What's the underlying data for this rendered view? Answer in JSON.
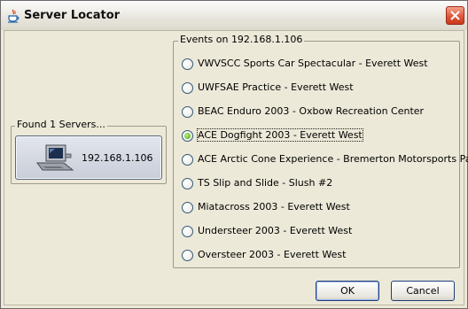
{
  "window": {
    "title": "Server Locator"
  },
  "servers_panel": {
    "legend": "Found 1 Servers...",
    "servers": [
      {
        "address": "192.168.1.106"
      }
    ]
  },
  "events_panel": {
    "legend": "Events on 192.168.1.106",
    "events": [
      {
        "label": "VWVSCC Sports Car Spectacular - Everett West",
        "selected": false
      },
      {
        "label": "UWFSAE Practice - Everett West",
        "selected": false
      },
      {
        "label": "BEAC Enduro 2003 - Oxbow Recreation Center",
        "selected": false
      },
      {
        "label": "ACE Dogfight 2003 - Everett West",
        "selected": true
      },
      {
        "label": "ACE Arctic Cone Experience - Bremerton Motorsports Park",
        "selected": false
      },
      {
        "label": "TS Slip and Slide - Slush #2",
        "selected": false
      },
      {
        "label": "Miatacross 2003 - Everett West",
        "selected": false
      },
      {
        "label": "Understeer 2003 - Everett West",
        "selected": false
      },
      {
        "label": "Oversteer 2003 - Everett West",
        "selected": false
      }
    ]
  },
  "buttons": {
    "ok": "OK",
    "cancel": "Cancel"
  }
}
